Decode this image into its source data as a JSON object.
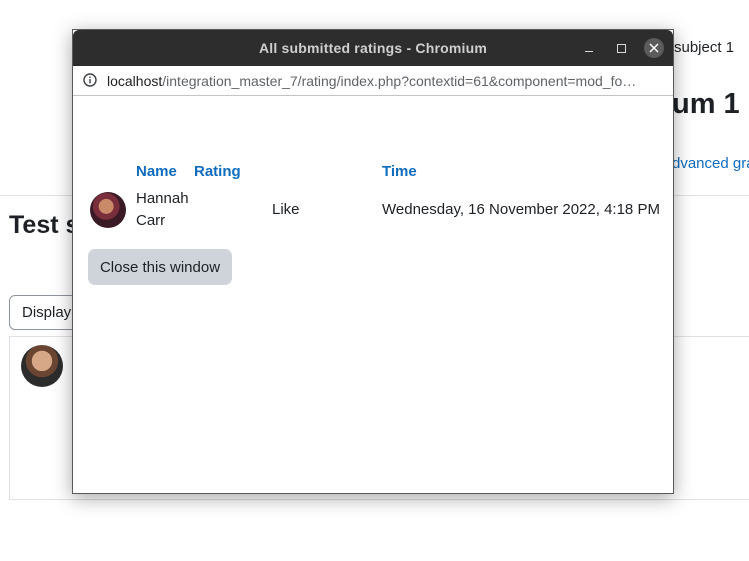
{
  "background_page": {
    "subject_text": "subject 1",
    "heading_fragment": "um 1",
    "advanced_link": "dvanced gra",
    "section_title": "Test s",
    "display_button": "Display"
  },
  "window": {
    "title": "All submitted ratings - Chromium",
    "address": {
      "host": "localhost",
      "path": "/integration_master_7/rating/index.php?contextid=61&component=mod_fo…"
    }
  },
  "ratings_table": {
    "headers": {
      "name": "Name",
      "rating": "Rating",
      "time": "Time"
    },
    "rows": [
      {
        "name": "Hannah Carr",
        "rating": "Like",
        "time": "Wednesday, 16 November 2022, 4:18 PM"
      }
    ]
  },
  "close_button_label": "Close this window",
  "colors": {
    "link": "#0f6cbf",
    "titlebar": "#2d2d2d",
    "button": "#ced4da"
  }
}
